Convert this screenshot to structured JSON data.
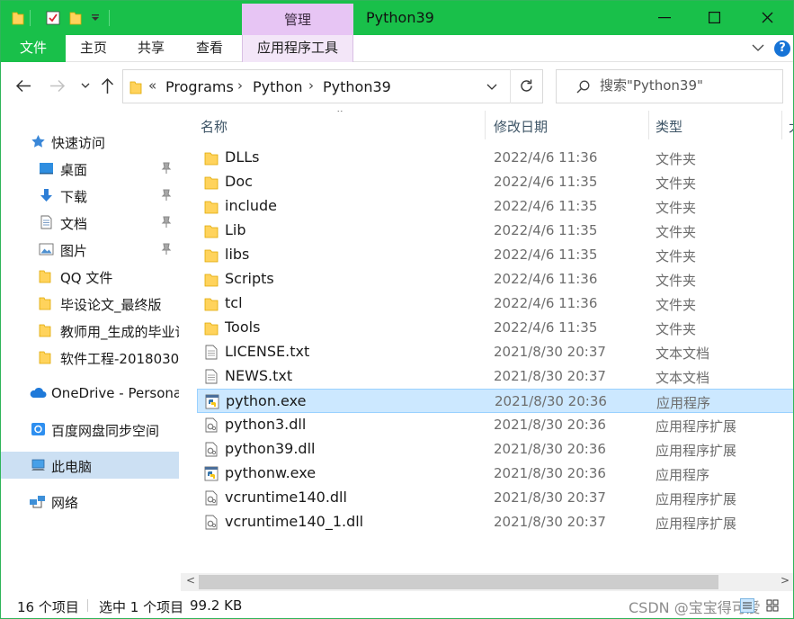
{
  "window": {
    "title": "Python39",
    "accent": "#19c04a"
  },
  "ribbon": {
    "manage_label": "管理",
    "file_label": "文件",
    "tabs": [
      {
        "label": "主页"
      },
      {
        "label": "共享"
      },
      {
        "label": "查看"
      }
    ],
    "app_tools_label": "应用程序工具",
    "help_label": "?"
  },
  "address": {
    "overflow": "«",
    "crumbs": [
      {
        "label": "Programs"
      },
      {
        "label": "Python"
      },
      {
        "label": "Python39"
      }
    ]
  },
  "search": {
    "placeholder": "搜索\"Python39\""
  },
  "nav": {
    "quick_access": "快速访问",
    "items": [
      {
        "label": "桌面",
        "icon": "desktop-icon",
        "pinned": true
      },
      {
        "label": "下载",
        "icon": "download-icon",
        "pinned": true
      },
      {
        "label": "文档",
        "icon": "document-icon",
        "pinned": true
      },
      {
        "label": "图片",
        "icon": "pictures-icon",
        "pinned": true
      },
      {
        "label": "QQ 文件",
        "icon": "folder-icon"
      },
      {
        "label": "毕设论文_最终版",
        "icon": "folder-icon"
      },
      {
        "label": "教师用_生成的毕业论",
        "icon": "folder-icon"
      },
      {
        "label": "软件工程-2018030",
        "icon": "folder-icon"
      }
    ],
    "onedrive": "OneDrive - Persona",
    "baidu": "百度网盘同步空间",
    "this_pc": "此电脑",
    "network": "网络"
  },
  "columns": {
    "name": "名称",
    "date": "修改日期",
    "type": "类型"
  },
  "files": [
    {
      "name": "DLLs",
      "date": "2022/4/6 11:36",
      "type": "文件夹",
      "icon": "folder-icon"
    },
    {
      "name": "Doc",
      "date": "2022/4/6 11:35",
      "type": "文件夹",
      "icon": "folder-icon"
    },
    {
      "name": "include",
      "date": "2022/4/6 11:35",
      "type": "文件夹",
      "icon": "folder-icon"
    },
    {
      "name": "Lib",
      "date": "2022/4/6 11:35",
      "type": "文件夹",
      "icon": "folder-icon"
    },
    {
      "name": "libs",
      "date": "2022/4/6 11:35",
      "type": "文件夹",
      "icon": "folder-icon"
    },
    {
      "name": "Scripts",
      "date": "2022/4/6 11:36",
      "type": "文件夹",
      "icon": "folder-icon"
    },
    {
      "name": "tcl",
      "date": "2022/4/6 11:36",
      "type": "文件夹",
      "icon": "folder-icon"
    },
    {
      "name": "Tools",
      "date": "2022/4/6 11:35",
      "type": "文件夹",
      "icon": "folder-icon"
    },
    {
      "name": "LICENSE.txt",
      "date": "2021/8/30 20:37",
      "type": "文本文档",
      "icon": "text-file-icon"
    },
    {
      "name": "NEWS.txt",
      "date": "2021/8/30 20:37",
      "type": "文本文档",
      "icon": "text-file-icon"
    },
    {
      "name": "python.exe",
      "date": "2021/8/30 20:36",
      "type": "应用程序",
      "icon": "python-exe-icon",
      "selected": true
    },
    {
      "name": "python3.dll",
      "date": "2021/8/30 20:36",
      "type": "应用程序扩展",
      "icon": "dll-file-icon"
    },
    {
      "name": "python39.dll",
      "date": "2021/8/30 20:36",
      "type": "应用程序扩展",
      "icon": "dll-file-icon"
    },
    {
      "name": "pythonw.exe",
      "date": "2021/8/30 20:36",
      "type": "应用程序",
      "icon": "python-exe-icon"
    },
    {
      "name": "vcruntime140.dll",
      "date": "2021/8/30 20:37",
      "type": "应用程序扩展",
      "icon": "dll-file-icon"
    },
    {
      "name": "vcruntime140_1.dll",
      "date": "2021/8/30 20:37",
      "type": "应用程序扩展",
      "icon": "dll-file-icon"
    }
  ],
  "status": {
    "count": "16 个项目",
    "selection": "选中 1 个项目",
    "size": "99.2 KB",
    "watermark": "CSDN @宝宝得可爱"
  }
}
